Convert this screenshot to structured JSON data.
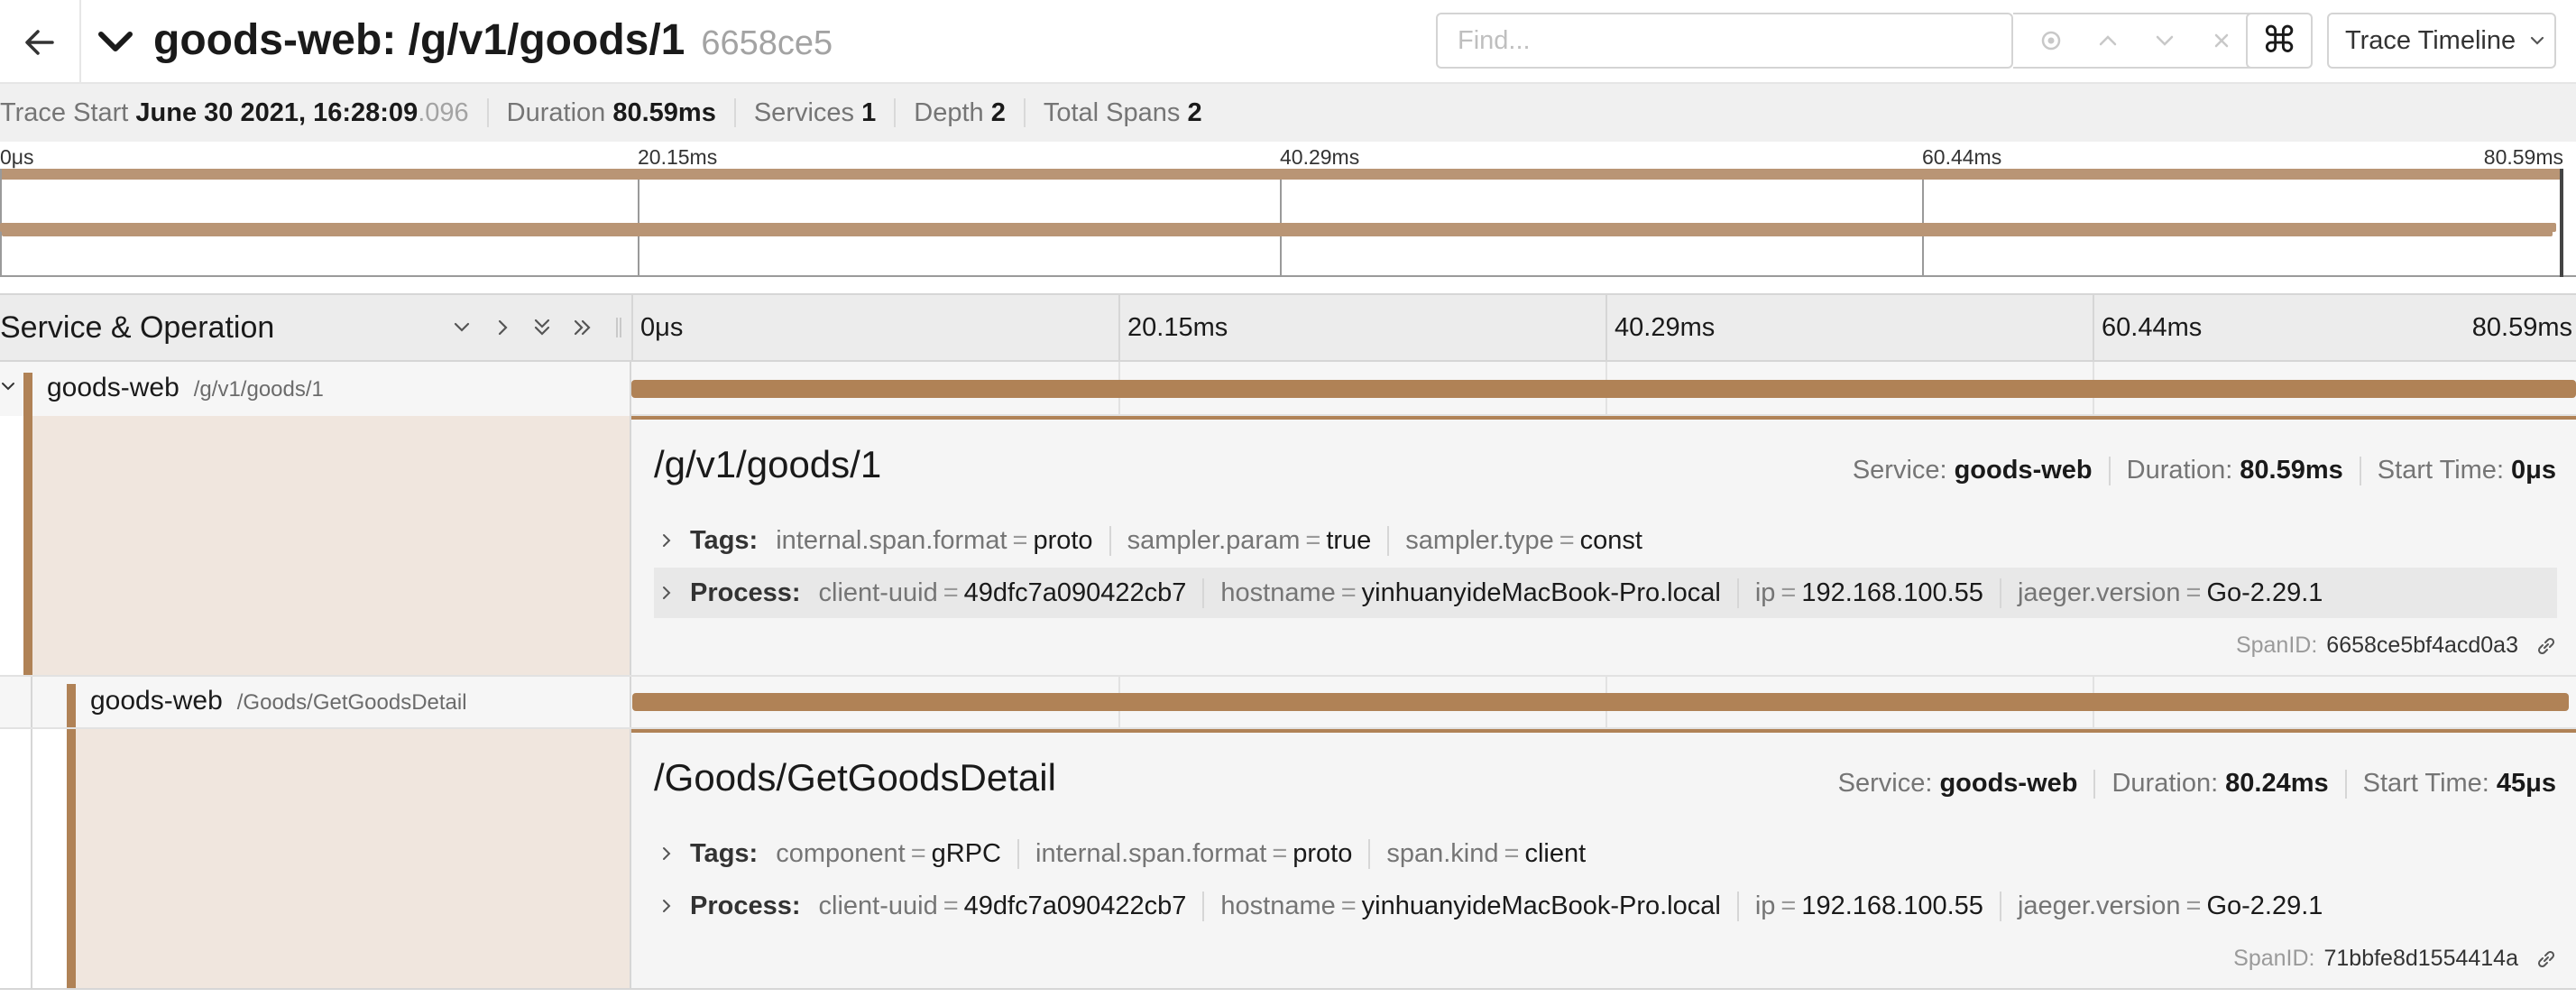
{
  "header": {
    "title": "goods-web: /g/v1/goods/1",
    "trace_id": "6658ce5",
    "find_placeholder": "Find...",
    "shortcut_glyph": "⌘",
    "view_mode": "Trace Timeline"
  },
  "summary": {
    "trace_start_label": "Trace Start",
    "trace_start_date": "June 30 2021, 16:28:09",
    "trace_start_ms": ".096",
    "duration_label": "Duration",
    "duration": "80.59ms",
    "services_label": "Services",
    "services": "1",
    "depth_label": "Depth",
    "depth": "2",
    "total_spans_label": "Total Spans",
    "total_spans": "2"
  },
  "ticks": [
    "0μs",
    "20.15ms",
    "40.29ms",
    "60.44ms",
    "80.59ms"
  ],
  "table": {
    "column_title": "Service & Operation"
  },
  "spans": [
    {
      "service": "goods-web",
      "operation": "/g/v1/goods/1",
      "start_fraction": 0.0,
      "duration_fraction": 1.0,
      "detail": {
        "title": "/g/v1/goods/1",
        "service_label": "Service:",
        "service": "goods-web",
        "duration_label": "Duration:",
        "duration": "80.59ms",
        "start_label": "Start Time:",
        "start": "0μs",
        "tags_label": "Tags:",
        "tags": [
          {
            "k": "internal.span.format",
            "v": "proto"
          },
          {
            "k": "sampler.param",
            "v": "true"
          },
          {
            "k": "sampler.type",
            "v": "const"
          }
        ],
        "process_label": "Process:",
        "process": [
          {
            "k": "client-uuid",
            "v": "49dfc7a090422cb7"
          },
          {
            "k": "hostname",
            "v": "yinhuanyideMacBook-Pro.local"
          },
          {
            "k": "ip",
            "v": "192.168.100.55"
          },
          {
            "k": "jaeger.version",
            "v": "Go-2.29.1"
          }
        ],
        "span_id_label": "SpanID:",
        "span_id": "6658ce5bf4acd0a3"
      }
    },
    {
      "service": "goods-web",
      "operation": "/Goods/GetGoodsDetail",
      "start_fraction": 0.0006,
      "duration_fraction": 0.9957,
      "detail": {
        "title": "/Goods/GetGoodsDetail",
        "service_label": "Service:",
        "service": "goods-web",
        "duration_label": "Duration:",
        "duration": "80.24ms",
        "start_label": "Start Time:",
        "start": "45μs",
        "tags_label": "Tags:",
        "tags": [
          {
            "k": "component",
            "v": "gRPC"
          },
          {
            "k": "internal.span.format",
            "v": "proto"
          },
          {
            "k": "span.kind",
            "v": "client"
          }
        ],
        "process_label": "Process:",
        "process": [
          {
            "k": "client-uuid",
            "v": "49dfc7a090422cb7"
          },
          {
            "k": "hostname",
            "v": "yinhuanyideMacBook-Pro.local"
          },
          {
            "k": "ip",
            "v": "192.168.100.55"
          },
          {
            "k": "jaeger.version",
            "v": "Go-2.29.1"
          }
        ],
        "span_id_label": "SpanID:",
        "span_id": "71bbfe8d1554414a"
      }
    }
  ],
  "colors": {
    "span_bar": "#b08256",
    "minimap_bar": "#b99575",
    "detail_left": "#f0e6de"
  }
}
